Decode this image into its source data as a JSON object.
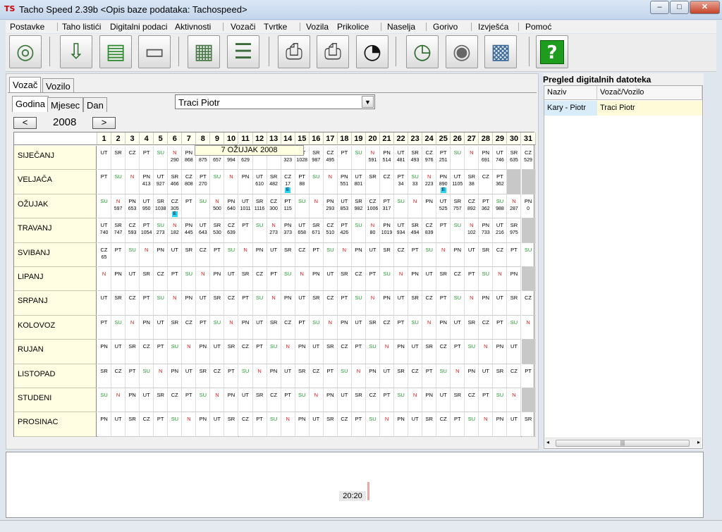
{
  "window": {
    "title": "Tacho Speed 2.39b <Opis baze podataka: Tachospeed>",
    "logo": "TS"
  },
  "window_buttons": [
    "–",
    "□",
    "✕"
  ],
  "menu": [
    "Postavke",
    "Taho listići",
    "Digitalni podaci",
    "Aktivnosti",
    "Vozači",
    "Tvrtke",
    "Vozila",
    "Prikolice",
    "Naselja",
    "Gorivo",
    "Izvješća",
    "Pomoć"
  ],
  "toolbar": [
    {
      "name": "cd-disc-icon",
      "label": ""
    },
    {
      "name": "ddd-download-icon",
      "label": "DDD"
    },
    {
      "name": "card-download-icon",
      "label": ""
    },
    {
      "name": "card-reader-icon",
      "label": ""
    },
    {
      "name": "keypad-icon",
      "label": ""
    },
    {
      "name": "list-numbered-icon",
      "label": ""
    },
    {
      "name": "printer-icon",
      "label": ""
    },
    {
      "name": "printer-settings-icon",
      "label": ""
    },
    {
      "name": "speedometer-icon",
      "label": ""
    },
    {
      "name": "clock-calculator-icon",
      "label": ""
    },
    {
      "name": "disc-stack-icon",
      "label": ""
    },
    {
      "name": "chart-report-icon",
      "label": ""
    },
    {
      "name": "help-icon",
      "label": "?"
    }
  ],
  "tabs_main": [
    "Vozač",
    "Vozilo"
  ],
  "tabs_period": [
    "Godina",
    "Mjesec",
    "Dan"
  ],
  "driver_select": "Traci Piotr",
  "nav": {
    "prev": "<",
    "next": ">",
    "year": "2008"
  },
  "tooltip": "7 OŽUJAK 2008",
  "days_header": [
    "1",
    "2",
    "3",
    "4",
    "5",
    "6",
    "7",
    "8",
    "9",
    "10",
    "11",
    "12",
    "13",
    "14",
    "15",
    "16",
    "17",
    "18",
    "19",
    "20",
    "21",
    "22",
    "23",
    "24",
    "25",
    "26",
    "27",
    "28",
    "29",
    "30",
    "31"
  ],
  "months": [
    {
      "name": "SIJEČANJ",
      "days": [
        "UT",
        "SR",
        "CZ",
        "PT",
        "SU",
        "N",
        "PN",
        "UT",
        "SR",
        "CZ",
        "PT",
        "SU",
        "N",
        "PN",
        "UT",
        "SR",
        "CZ",
        "PT",
        "SU",
        "N",
        "PN",
        "UT",
        "SR",
        "CZ",
        "PT",
        "SU",
        "N",
        "PN",
        "UT",
        "SR",
        "CZ"
      ],
      "km": [
        "",
        "",
        "",
        "",
        "",
        "290",
        "868",
        "875",
        "657",
        "994",
        "629",
        "",
        "",
        "323",
        "1028",
        "987",
        "495",
        "",
        "",
        "591",
        "514",
        "481",
        "493",
        "976",
        "251",
        "",
        "",
        "691",
        "746",
        "635",
        "529"
      ]
    },
    {
      "name": "VELJAČA",
      "days": [
        "PT",
        "SU",
        "N",
        "PN",
        "UT",
        "SR",
        "CZ",
        "PT",
        "SU",
        "N",
        "PN",
        "UT",
        "SR",
        "CZ",
        "PT",
        "SU",
        "N",
        "PN",
        "UT",
        "SR",
        "CZ",
        "PT",
        "SU",
        "N",
        "PN",
        "UT",
        "SR",
        "CZ",
        "PT",
        "",
        ""
      ],
      "km": [
        "",
        "",
        "",
        "413",
        "927",
        "466",
        "808",
        "270",
        "",
        "",
        "",
        "610",
        "482",
        "17",
        "88",
        "",
        "",
        "551",
        "801",
        "",
        "",
        "34",
        "33",
        "223",
        "890",
        "1105",
        "38",
        "",
        "362",
        "",
        ""
      ],
      "flags": [
        13,
        24
      ]
    },
    {
      "name": "OŽUJAK",
      "days": [
        "SU",
        "N",
        "PN",
        "UT",
        "SR",
        "CZ",
        "PT",
        "SU",
        "N",
        "PN",
        "UT",
        "SR",
        "CZ",
        "PT",
        "SU",
        "N",
        "PN",
        "UT",
        "SR",
        "CZ",
        "PT",
        "SU",
        "N",
        "PN",
        "UT",
        "SR",
        "CZ",
        "PT",
        "SU",
        "N",
        "PN"
      ],
      "km": [
        "",
        "597",
        "653",
        "950",
        "1038",
        "305",
        "",
        "",
        "500",
        "640",
        "1011",
        "1116",
        "300",
        "115",
        "",
        "",
        "293",
        "853",
        "982",
        "1006",
        "317",
        "",
        "",
        "",
        "525",
        "757",
        "892",
        "362",
        "988",
        "287",
        "0"
      ],
      "flags": [
        5
      ]
    },
    {
      "name": "TRAVANJ",
      "days": [
        "UT",
        "SR",
        "CZ",
        "PT",
        "SU",
        "N",
        "PN",
        "UT",
        "SR",
        "CZ",
        "PT",
        "SU",
        "N",
        "PN",
        "UT",
        "SR",
        "CZ",
        "PT",
        "SU",
        "N",
        "PN",
        "UT",
        "SR",
        "CZ",
        "PT",
        "SU",
        "N",
        "PN",
        "UT",
        "SR",
        ""
      ],
      "km": [
        "740",
        "747",
        "593",
        "1054",
        "273",
        "182",
        "445",
        "643",
        "530",
        "639",
        "",
        "",
        "273",
        "373",
        "658",
        "671",
        "510",
        "426",
        "",
        "80",
        "1019",
        "934",
        "494",
        "839",
        "",
        "",
        "102",
        "733",
        "216",
        "975",
        ""
      ]
    },
    {
      "name": "SVIBANJ",
      "days": [
        "CZ",
        "PT",
        "SU",
        "N",
        "PN",
        "UT",
        "SR",
        "CZ",
        "PT",
        "SU",
        "N",
        "PN",
        "UT",
        "SR",
        "CZ",
        "PT",
        "SU",
        "N",
        "PN",
        "UT",
        "SR",
        "CZ",
        "PT",
        "SU",
        "N",
        "PN",
        "UT",
        "SR",
        "CZ",
        "PT",
        "SU"
      ],
      "km": [
        "65",
        "",
        "",
        "",
        "",
        "",
        "",
        "",
        "",
        "",
        "",
        "",
        "",
        "",
        "",
        "",
        "",
        "",
        "",
        "",
        "",
        "",
        "",
        "",
        "",
        "",
        "",
        "",
        "",
        "",
        ""
      ]
    },
    {
      "name": "LIPANJ",
      "days": [
        "N",
        "PN",
        "UT",
        "SR",
        "CZ",
        "PT",
        "SU",
        "N",
        "PN",
        "UT",
        "SR",
        "CZ",
        "PT",
        "SU",
        "N",
        "PN",
        "UT",
        "SR",
        "CZ",
        "PT",
        "SU",
        "N",
        "PN",
        "UT",
        "SR",
        "CZ",
        "PT",
        "SU",
        "N",
        "PN",
        ""
      ],
      "km": []
    },
    {
      "name": "SRPANJ",
      "days": [
        "UT",
        "SR",
        "CZ",
        "PT",
        "SU",
        "N",
        "PN",
        "UT",
        "SR",
        "CZ",
        "PT",
        "SU",
        "N",
        "PN",
        "UT",
        "SR",
        "CZ",
        "PT",
        "SU",
        "N",
        "PN",
        "UT",
        "SR",
        "CZ",
        "PT",
        "SU",
        "N",
        "PN",
        "UT",
        "SR",
        "CZ"
      ],
      "km": []
    },
    {
      "name": "KOLOVOZ",
      "days": [
        "PT",
        "SU",
        "N",
        "PN",
        "UT",
        "SR",
        "CZ",
        "PT",
        "SU",
        "N",
        "PN",
        "UT",
        "SR",
        "CZ",
        "PT",
        "SU",
        "N",
        "PN",
        "UT",
        "SR",
        "CZ",
        "PT",
        "SU",
        "N",
        "PN",
        "UT",
        "SR",
        "CZ",
        "PT",
        "SU",
        "N"
      ],
      "km": []
    },
    {
      "name": "RUJAN",
      "days": [
        "PN",
        "UT",
        "SR",
        "CZ",
        "PT",
        "SU",
        "N",
        "PN",
        "UT",
        "SR",
        "CZ",
        "PT",
        "SU",
        "N",
        "PN",
        "UT",
        "SR",
        "CZ",
        "PT",
        "SU",
        "N",
        "PN",
        "UT",
        "SR",
        "CZ",
        "PT",
        "SU",
        "N",
        "PN",
        "UT",
        ""
      ],
      "km": []
    },
    {
      "name": "LISTOPAD",
      "days": [
        "SR",
        "CZ",
        "PT",
        "SU",
        "N",
        "PN",
        "UT",
        "SR",
        "CZ",
        "PT",
        "SU",
        "N",
        "PN",
        "UT",
        "SR",
        "CZ",
        "PT",
        "SU",
        "N",
        "PN",
        "UT",
        "SR",
        "CZ",
        "PT",
        "SU",
        "N",
        "PN",
        "UT",
        "SR",
        "CZ",
        "PT"
      ],
      "km": []
    },
    {
      "name": "STUDENI",
      "days": [
        "SU",
        "N",
        "PN",
        "UT",
        "SR",
        "CZ",
        "PT",
        "SU",
        "N",
        "PN",
        "UT",
        "SR",
        "CZ",
        "PT",
        "SU",
        "N",
        "PN",
        "UT",
        "SR",
        "CZ",
        "PT",
        "SU",
        "N",
        "PN",
        "UT",
        "SR",
        "CZ",
        "PT",
        "SU",
        "N",
        ""
      ],
      "km": []
    },
    {
      "name": "PROSINAC",
      "days": [
        "PN",
        "UT",
        "SR",
        "CZ",
        "PT",
        "SU",
        "N",
        "PN",
        "UT",
        "SR",
        "CZ",
        "PT",
        "SU",
        "N",
        "PN",
        "UT",
        "SR",
        "CZ",
        "PT",
        "SU",
        "N",
        "PN",
        "UT",
        "SR",
        "CZ",
        "PT",
        "SU",
        "N",
        "PN",
        "UT",
        "SR"
      ],
      "km": []
    }
  ],
  "day_colors": {
    "SU": "#1f9d2a",
    "N": "#e02020"
  },
  "right_panel": {
    "title": "Pregled digitalnih datoteka",
    "columns": [
      "Naziv",
      "Vozač/Vozilo"
    ],
    "rows": [
      [
        "Kary - Piotr",
        "Traci Piotr"
      ]
    ]
  },
  "timeline": {
    "label": "20:20"
  }
}
